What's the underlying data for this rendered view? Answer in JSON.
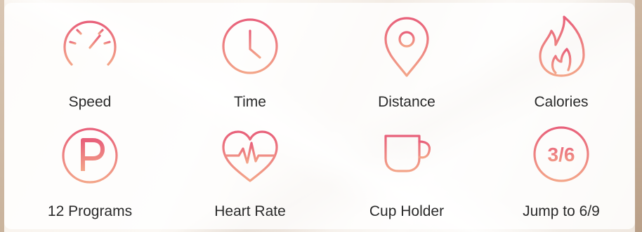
{
  "colors": {
    "icon_gradient_top": "#e8607a",
    "icon_gradient_bottom": "#f3a589",
    "label_text": "#2a2a2a"
  },
  "features": [
    {
      "icon": "speedometer-icon",
      "label": "Speed"
    },
    {
      "icon": "clock-icon",
      "label": "Time"
    },
    {
      "icon": "location-pin-icon",
      "label": "Distance"
    },
    {
      "icon": "flame-icon",
      "label": "Calories"
    },
    {
      "icon": "programs-p-icon",
      "label": "12 Programs"
    },
    {
      "icon": "heart-rate-icon",
      "label": "Heart Rate"
    },
    {
      "icon": "cup-icon",
      "label": "Cup Holder"
    },
    {
      "icon": "jump-badge-icon",
      "label": "Jump to 6/9",
      "badge_text": "3/6"
    }
  ]
}
